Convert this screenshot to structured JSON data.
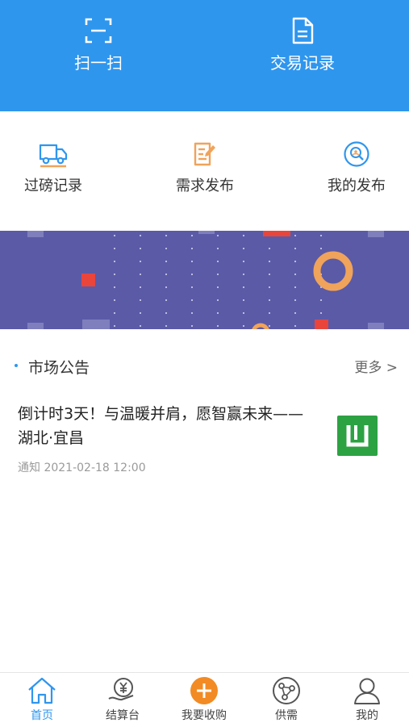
{
  "header": {
    "scan_label": "扫一扫",
    "records_label": "交易记录"
  },
  "quick_actions": [
    {
      "label": "过磅记录",
      "icon": "truck-icon"
    },
    {
      "label": "需求发布",
      "icon": "edit-document-icon"
    },
    {
      "label": "我的发布",
      "icon": "search-user-icon"
    }
  ],
  "notice": {
    "section_title": "市场公告",
    "more_label": "更多 >",
    "items": [
      {
        "title": "倒计时3天！与温暖并肩，愿智赢未来——湖北·宜昌",
        "meta": "通知 2021-02-18 12:00"
      }
    ]
  },
  "tabbar": {
    "items": [
      {
        "label": "首页",
        "icon": "home-icon",
        "active": true
      },
      {
        "label": "结算台",
        "icon": "yuan-coin-icon",
        "active": false
      },
      {
        "label": "我要收购",
        "icon": "plus-circle-icon",
        "active": false
      },
      {
        "label": "供需",
        "icon": "network-icon",
        "active": false
      },
      {
        "label": "我的",
        "icon": "user-icon",
        "active": false
      }
    ]
  },
  "colors": {
    "primary": "#2f96ee",
    "banner_bg": "#5b5aa7",
    "accent_orange": "#f0a35a",
    "tab_plus": "#f28b23",
    "thumb_green": "#2ca243"
  }
}
